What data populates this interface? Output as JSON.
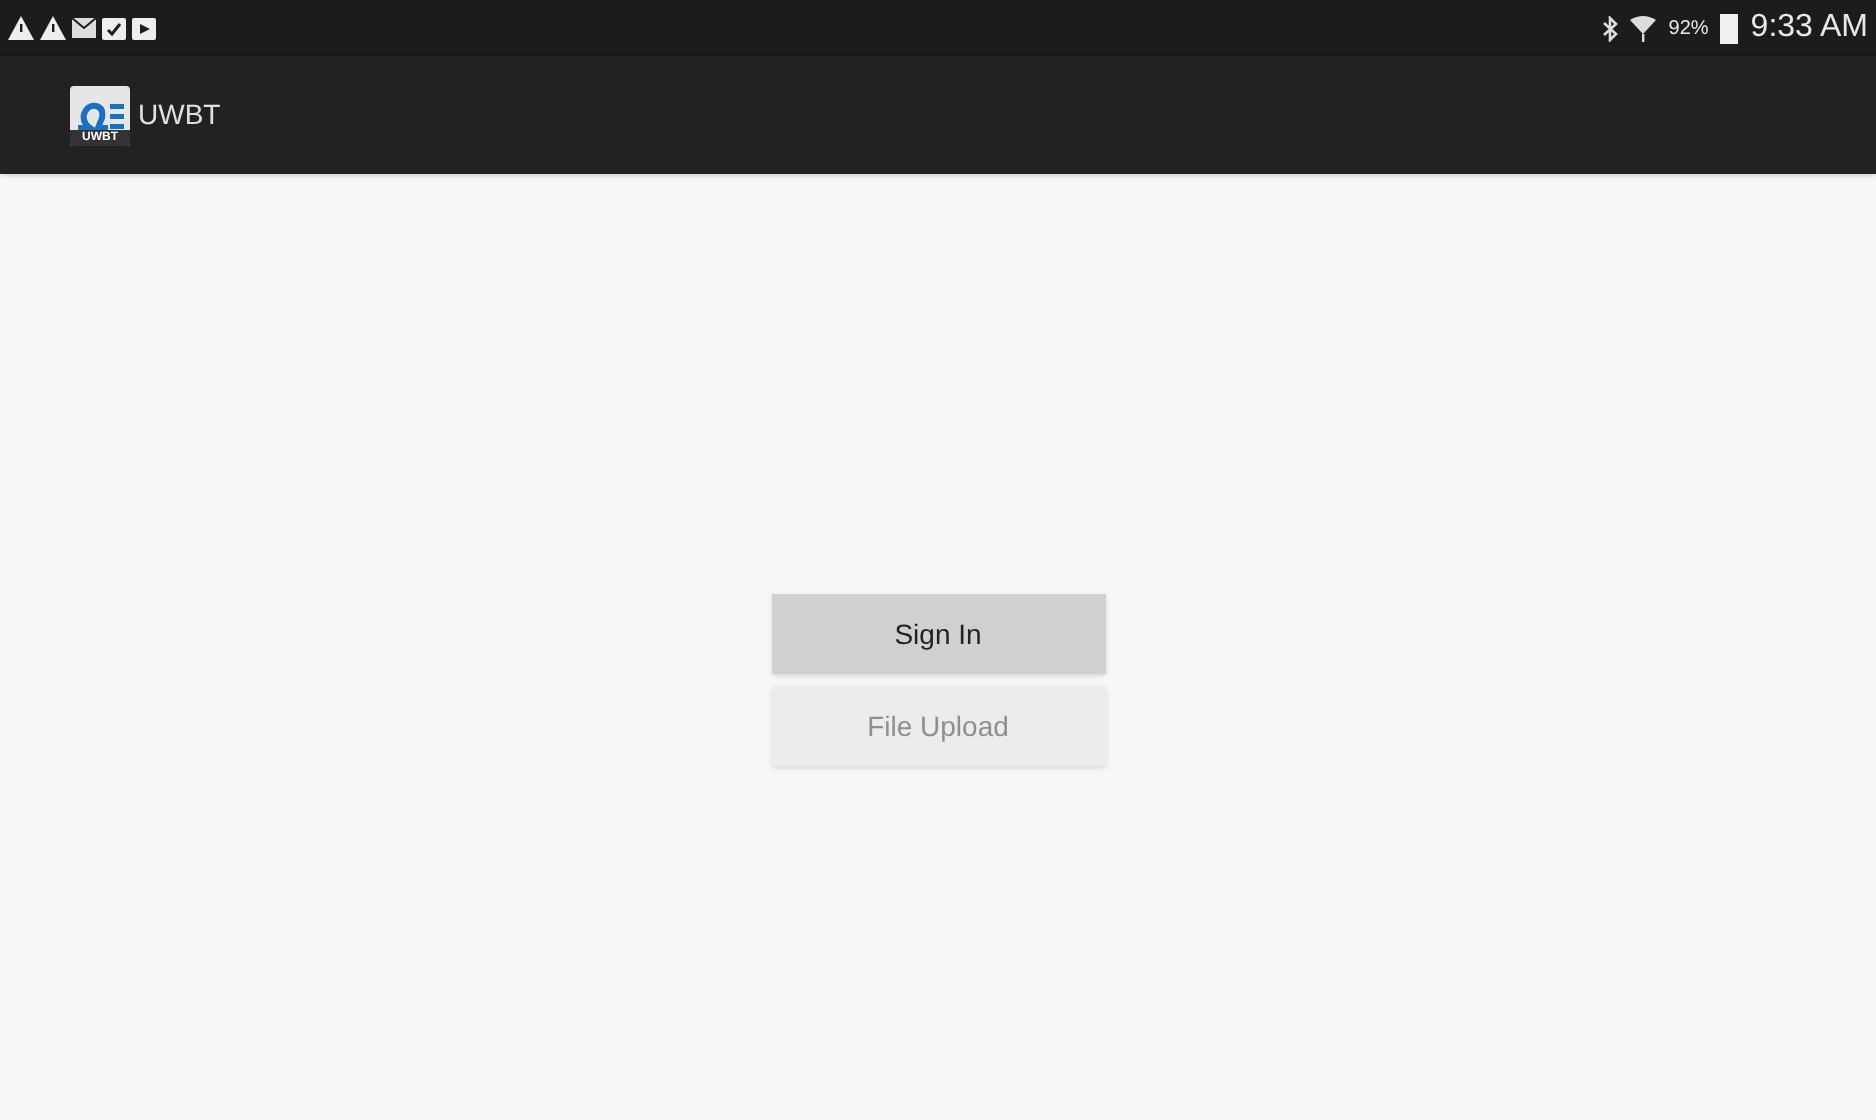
{
  "status_bar": {
    "battery": "92%",
    "time": "9:33 AM"
  },
  "app_bar": {
    "logo_text": "UWBT",
    "title": "UWBT"
  },
  "buttons": [
    {
      "label": "Sign In",
      "disabled": false
    },
    {
      "label": "File Upload",
      "disabled": true
    }
  ]
}
